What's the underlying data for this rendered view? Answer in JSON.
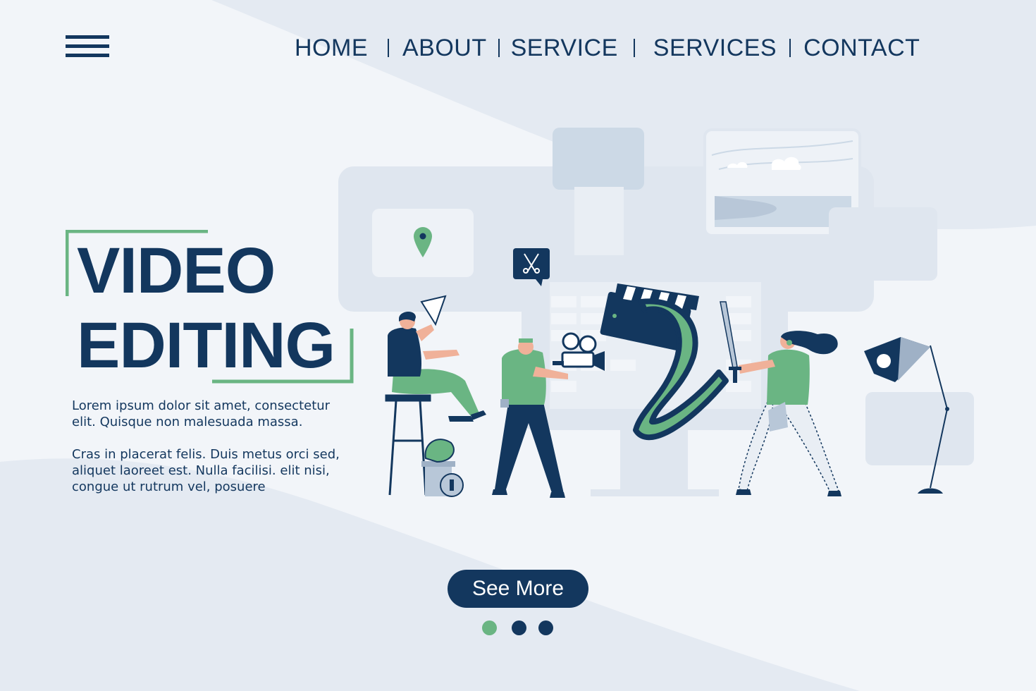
{
  "nav": {
    "menu_icon": "hamburger-menu-icon",
    "items": [
      {
        "label": "HOME"
      },
      {
        "label": "ABOUT"
      },
      {
        "label": "SERVICE"
      },
      {
        "label": "SERVICES"
      },
      {
        "label": "CONTACT"
      }
    ]
  },
  "hero": {
    "title_line1": "VIDEO",
    "title_line2": "EDITING",
    "paragraph1": "Lorem ipsum dolor sit amet, consectetur elit. Quisque non malesuada massa.",
    "paragraph2": "Cras in placerat felis. Duis metus orci sed, aliquet laoreet est. Nulla facilisi. elit nisi, congue ut rutrum vel, posuere",
    "cta_label": "See More"
  },
  "pagination": {
    "total": 3,
    "active_index": 0
  },
  "colors": {
    "primary": "#13375e",
    "accent": "#6ab583",
    "background": "#f2f5f9",
    "panel": "#dfe6ef"
  },
  "illustration": {
    "icons": [
      "location-pin-icon",
      "scissors-icon",
      "megaphone-icon",
      "film-camera-icon",
      "clapperboard-icon",
      "film-strip-icon",
      "sword-icon",
      "studio-lamp-icon",
      "trash-can-icon"
    ]
  }
}
